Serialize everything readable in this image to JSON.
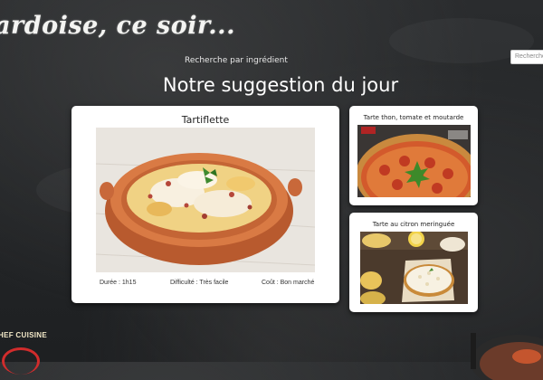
{
  "header": {
    "site_title": "ardoise, ce soir...",
    "search_placeholder": "Recherche"
  },
  "nav": {
    "ingredient_search": "Recherche par ingrédient"
  },
  "main": {
    "heading": "Notre suggestion du jour",
    "featured": {
      "title": "Tartiflette",
      "image_icon": "tartiflette-dish-photo",
      "duration": "Durée : 1h15",
      "difficulty": "Difficulté : Très facile",
      "cost": "Coût : Bon marché"
    },
    "side_recipes": [
      {
        "title": "Tarte thon, tomate et moutarde",
        "image_icon": "tuna-tomato-tart-photo"
      },
      {
        "title": "Tarte au citron meringuée",
        "image_icon": "lemon-meringue-tart-photo"
      }
    ]
  },
  "footer": {
    "brand": "HEF CUISINE"
  }
}
